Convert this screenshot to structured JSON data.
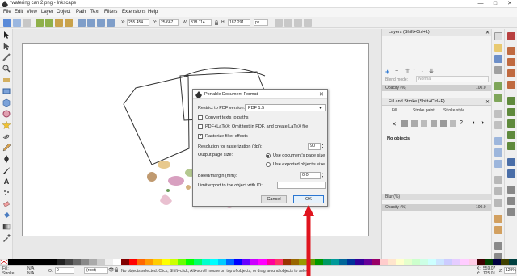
{
  "window": {
    "title": "*watering can 2.png - Inkscape",
    "minimize": "—",
    "maximize": "□",
    "close": "✕"
  },
  "menu": [
    "File",
    "Edit",
    "View",
    "Layer",
    "Object",
    "Path",
    "Text",
    "Filters",
    "Extensions",
    "Help"
  ],
  "toolbar": {
    "x_label": "X:",
    "x_value": "255.454",
    "y_label": "Y:",
    "y_value": "25.667",
    "w_label": "W:",
    "w_value": "318.114",
    "h_label": "H:",
    "h_value": "187.291",
    "unit": "px"
  },
  "layers_panel": {
    "title": "Layers (Shift+Ctrl+L)",
    "blend_label": "Blend mode:",
    "blend_value": "Normal",
    "opacity_label": "Opacity (%)",
    "opacity_value": "100.0"
  },
  "fill_stroke_panel": {
    "title": "Fill and Stroke (Shift+Ctrl+F)",
    "tabs": [
      "Fill",
      "Stroke paint",
      "Stroke style"
    ],
    "no_objects": "No objects",
    "blur_label": "Blur (%)",
    "opacity_label": "Opacity (%)",
    "opacity_value": "100.0"
  },
  "dialog": {
    "title": "Portable Document Format",
    "restrict_label": "Restrict to PDF version:",
    "restrict_value": "PDF 1.5",
    "convert_texts": "Convert texts to paths",
    "pdf_latex": "PDF+LaTeX: Omit text in PDF, and create LaTeX file",
    "rasterize": "Rasterize filter effects",
    "resolution_label": "Resolution for rasterization (dpi):",
    "resolution_value": "90",
    "output_size_label": "Output page size:",
    "use_document": "Use document's page size",
    "use_exported": "Use exported object's size",
    "bleed_label": "Bleed/margin (mm):",
    "bleed_value": "0.0",
    "limit_label": "Limit export to the object with ID:",
    "limit_value": "",
    "cancel": "Cancel",
    "ok": "OK"
  },
  "status": {
    "fill_label": "Fill:",
    "fill_value": "N/A",
    "stroke_label": "Stroke:",
    "stroke_value": "N/A",
    "opacity_label": "O:",
    "opacity_value": "0",
    "layer_value": "(root)",
    "message": "No objects selected. Click, Shift+click, Alt+scroll mouse on top of objects, or drag around objects to select.",
    "x_label": "X:",
    "x_value": "559.07",
    "y_label": "Y:",
    "y_value": "125.01",
    "z_label": "Z:",
    "zoom_value": "129%"
  },
  "colors": {
    "accent_blue": "#2a76d2",
    "arrow_red": "#e0141e"
  }
}
